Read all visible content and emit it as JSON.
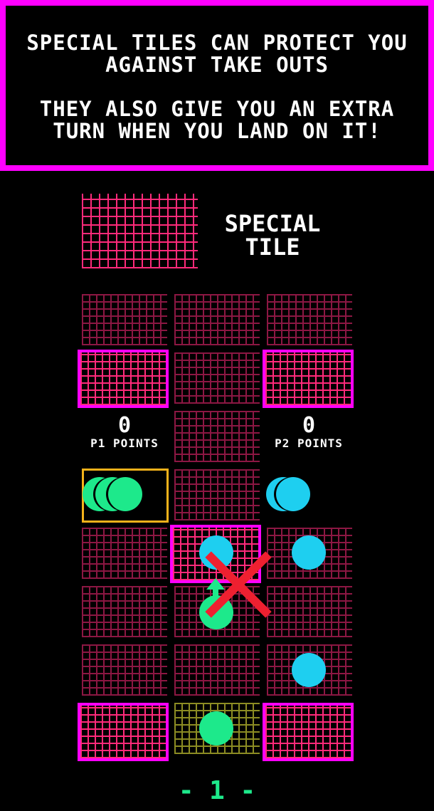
{
  "banner": {
    "line1": "SPECIAL TILES CAN PROTECT YOU",
    "line2": "AGAINST TAKE OUTS",
    "line3": "THEY ALSO GIVE YOU AN EXTRA",
    "line4": "TURN WHEN YOU LAND ON IT!"
  },
  "legend": {
    "line1": "SPECIAL",
    "line2": "TILE"
  },
  "scores": {
    "p1": {
      "value": "0",
      "label": "P1 POINTS"
    },
    "p2": {
      "value": "0",
      "label": "P2 POINTS"
    }
  },
  "home": {
    "p1_pieces_waiting": 3,
    "p2_pieces_waiting": 2
  },
  "turn": {
    "text": "- 1 -"
  },
  "colors": {
    "special_border": "#ff00ff",
    "p1": "#1de98b",
    "p2": "#1ecff0",
    "home_highlight": "#f5b21a",
    "invalid": "#ee2030"
  }
}
